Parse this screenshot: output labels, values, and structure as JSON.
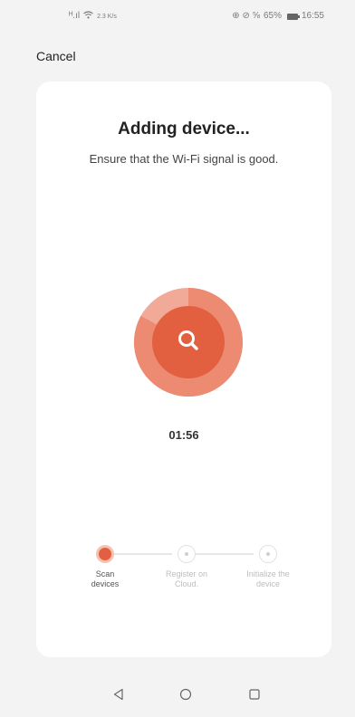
{
  "status_bar": {
    "signal_text": "ᴴ.ıl",
    "wifi_icon": "wifi-icon",
    "speed_text": "2.3 K/s",
    "right_icons": "⊕ ⊘ ⅝",
    "battery_text": "65%",
    "time": "16:55"
  },
  "header": {
    "cancel_label": "Cancel"
  },
  "card": {
    "title": "Adding device...",
    "subtitle": "Ensure that the Wi-Fi signal is good.",
    "timer": "01:56",
    "progress_fraction": 0.83
  },
  "steps": [
    {
      "label_line1": "Scan",
      "label_line2": "devices",
      "active": true
    },
    {
      "label_line1": "Register on",
      "label_line2": "Cloud.",
      "active": false
    },
    {
      "label_line1": "Initialize the",
      "label_line2": "device",
      "active": false
    }
  ],
  "colors": {
    "accent": "#e2603f",
    "accent_light": "#f1aa98",
    "background": "#f3f3f4",
    "card": "#ffffff"
  },
  "nav_bar": {
    "back_icon": "back-triangle-icon",
    "home_icon": "home-circle-icon",
    "recents_icon": "recents-square-icon"
  }
}
